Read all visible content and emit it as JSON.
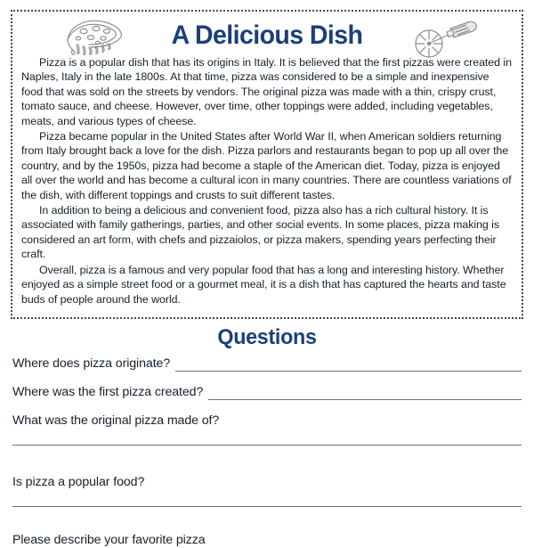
{
  "worksheet": {
    "title": "A Delicious Dish",
    "icons": {
      "left": "pizza-slice-icon",
      "right": "pizza-cutter-icon"
    },
    "passage": [
      "Pizza is a popular dish that has its origins in Italy. It is believed that the first pizzas were created in Naples, Italy in the late 1800s. At that time, pizza was considered to be a simple and inexpensive food that was sold on the streets by vendors. The original pizza was made with a thin, crispy crust, tomato sauce, and cheese. However, over time, other toppings were added, including vegetables, meats, and various types of cheese.",
      "Pizza became popular in the United States after World War II, when American soldiers returning from Italy brought back a love for the dish. Pizza parlors and restaurants began to pop up all over the country, and by the 1950s, pizza had become a staple of the American diet. Today, pizza is enjoyed all over the world and has become a cultural icon in many countries. There are countless variations of the dish, with different toppings and crusts to suit different tastes.",
      " In addition to being a delicious and convenient food, pizza also has a rich cultural history. It is associated with family gatherings, parties, and other social events. In some places, pizza making is considered an art form, with chefs and pizzaiolos, or pizza makers, spending years perfecting their craft.",
      "Overall, pizza is a famous and very popular food that has a long and interesting history. Whether enjoyed as a simple street food or a gourmet meal, it is a dish that has captured the hearts and taste buds of people around the world."
    ]
  },
  "questions_section": {
    "heading": "Questions",
    "items": [
      {
        "text": "Where does pizza originate?",
        "line_style": "inline"
      },
      {
        "text": "Where was the first pizza created?",
        "line_style": "inline"
      },
      {
        "text": "What was the original pizza made of?",
        "line_style": "below"
      },
      {
        "text": "Is pizza a popular food?",
        "line_style": "below"
      },
      {
        "text": "Please describe your favorite pizza",
        "line_style": "none"
      }
    ]
  },
  "colors": {
    "title_blue": "#1b3f7a",
    "text": "#16202c",
    "line": "#6e6e6e",
    "border": "#4a4a4a"
  }
}
